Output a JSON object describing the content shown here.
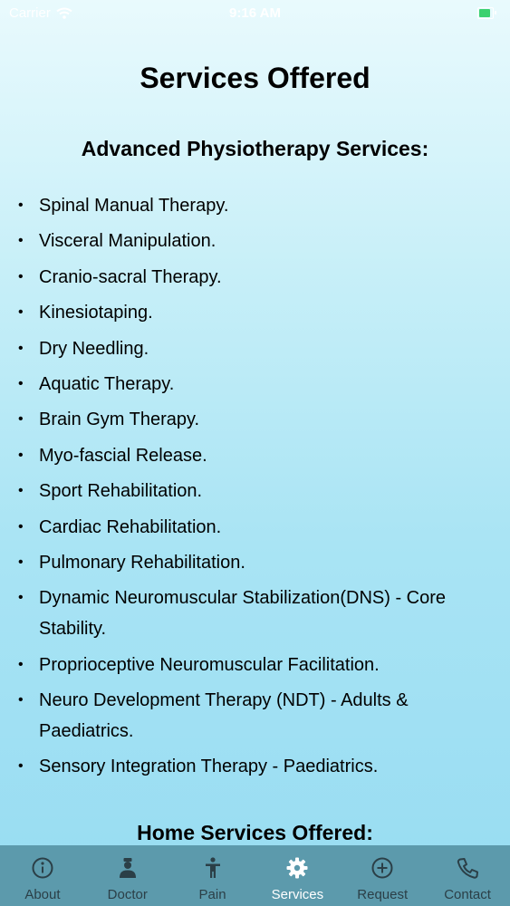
{
  "status_bar": {
    "carrier": "Carrier",
    "time": "9:16 AM",
    "battery_level": 0.85
  },
  "page": {
    "title": "Services Offered"
  },
  "advanced_section": {
    "title": "Advanced Physiotherapy Services:",
    "items": [
      "Spinal Manual Therapy.",
      "Visceral Manipulation.",
      "Cranio-sacral Therapy.",
      "Kinesiotaping.",
      "Dry Needling.",
      "Aquatic Therapy.",
      "Brain Gym Therapy.",
      "Myo-fascial Release.",
      "Sport Rehabilitation.",
      "Cardiac Rehabilitation.",
      "Pulmonary Rehabilitation.",
      "Dynamic Neuromuscular Stabilization(DNS) - Core Stability.",
      "Proprioceptive Neuromuscular Facilitation.",
      "Neuro Development Therapy (NDT) - Adults & Paediatrics.",
      "Sensory Integration Therapy - Paediatrics."
    ]
  },
  "home_section": {
    "title": "Home Services Offered:"
  },
  "tab_bar": {
    "tabs": [
      {
        "label": "About",
        "icon": "info-icon"
      },
      {
        "label": "Doctor",
        "icon": "doctor-icon"
      },
      {
        "label": "Pain",
        "icon": "person-icon"
      },
      {
        "label": "Services",
        "icon": "gear-icon"
      },
      {
        "label": "Request",
        "icon": "plus-circle-icon"
      },
      {
        "label": "Contact",
        "icon": "phone-icon"
      }
    ],
    "active_tab": "Services",
    "active_color": "#ffffff",
    "inactive_color": "#2b3f47",
    "background": "#5c9aac"
  }
}
